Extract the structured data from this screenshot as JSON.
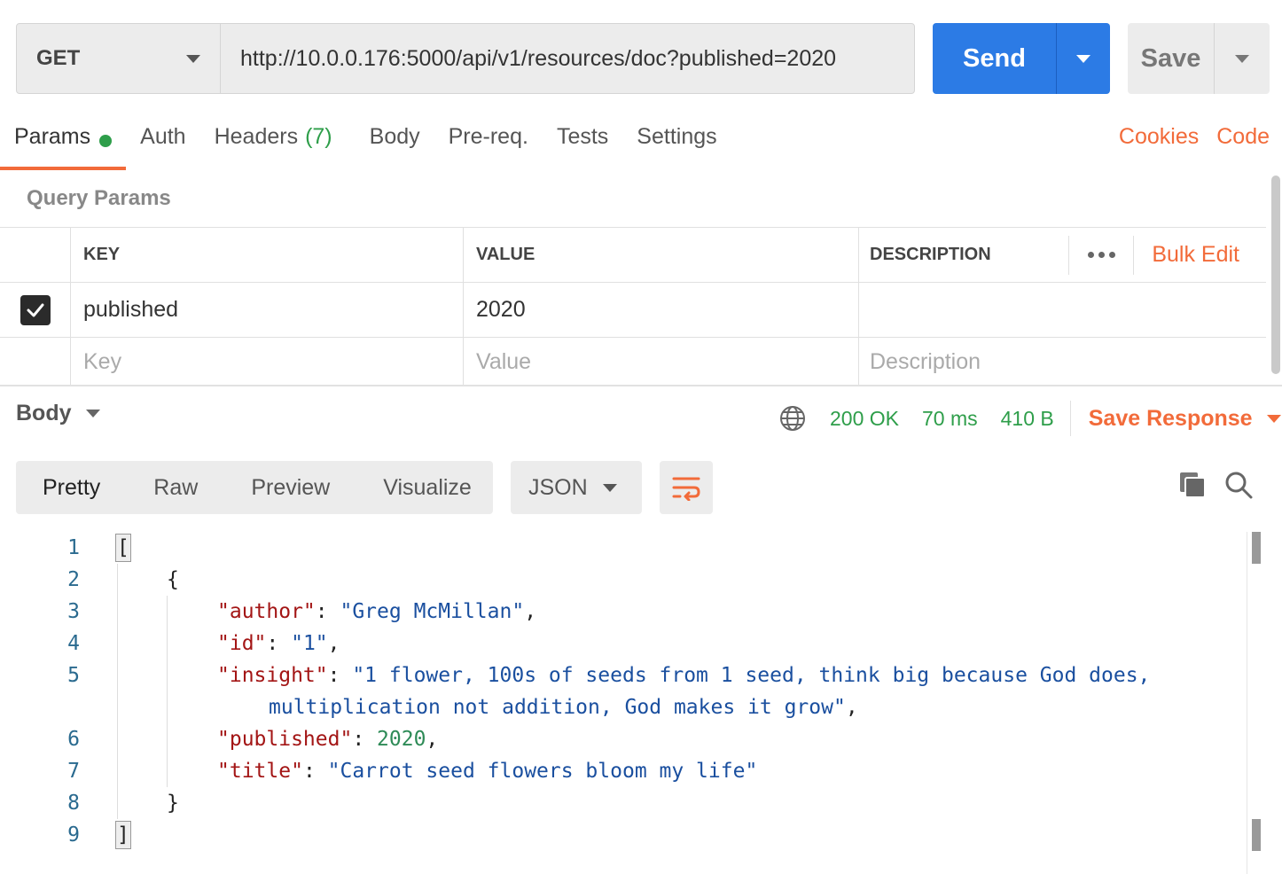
{
  "request": {
    "method": "GET",
    "url": "http://10.0.0.176:5000/api/v1/resources/doc?published=2020",
    "send_label": "Send",
    "save_label": "Save"
  },
  "tabs": [
    {
      "label": "Params"
    },
    {
      "label": "Auth"
    },
    {
      "label": "Headers",
      "count": "(7)"
    },
    {
      "label": "Body"
    },
    {
      "label": "Pre-req."
    },
    {
      "label": "Tests"
    },
    {
      "label": "Settings"
    }
  ],
  "links": {
    "cookies": "Cookies",
    "code": "Code"
  },
  "query_params": {
    "title": "Query Params",
    "headers": {
      "key": "KEY",
      "value": "VALUE",
      "description": "DESCRIPTION",
      "bulk_edit": "Bulk Edit"
    },
    "rows": [
      {
        "key": "published",
        "value": "2020",
        "checked": true
      }
    ],
    "placeholders": {
      "key": "Key",
      "value": "Value",
      "description": "Description"
    }
  },
  "response": {
    "body_label": "Body",
    "status": "200 OK",
    "time": "70 ms",
    "size": "410 B",
    "save_response": "Save Response",
    "view_tabs": [
      "Pretty",
      "Raw",
      "Preview",
      "Visualize"
    ],
    "format": "JSON",
    "code": {
      "author_key": "\"author\"",
      "author_val": "\"Greg McMillan\"",
      "id_key": "\"id\"",
      "id_val": "\"1\"",
      "insight_key": "\"insight\"",
      "insight_val_1": "\"1 flower, 100s of seeds from 1 seed, think big because God does,",
      "insight_val_2": "multiplication not addition, God makes it grow\"",
      "published_key": "\"published\"",
      "published_val": "2020",
      "title_key": "\"title\"",
      "title_val": "\"Carrot seed flowers bloom my life\""
    },
    "line_numbers": [
      "1",
      "2",
      "3",
      "4",
      "5",
      "6",
      "7",
      "8",
      "9"
    ]
  },
  "colors": {
    "accent": "#f26b3a",
    "send": "#2c7be5",
    "status_ok": "#2e9e4a"
  }
}
